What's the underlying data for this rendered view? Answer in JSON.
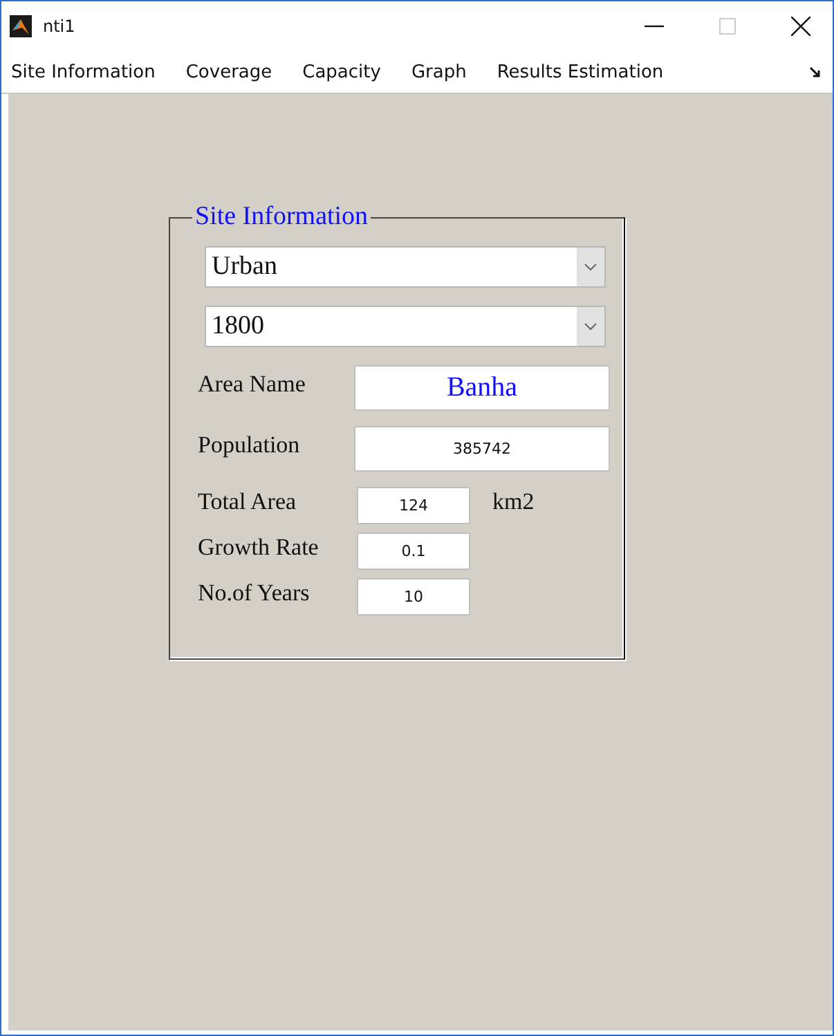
{
  "window": {
    "title": "nti1"
  },
  "menu": [
    "Site Information",
    "Coverage",
    "Capacity",
    "Graph",
    "Results Estimation"
  ],
  "panel": {
    "title": "Site Information",
    "dropdowns": [
      {
        "value": "Urban"
      },
      {
        "value": "1800"
      }
    ],
    "fields": [
      {
        "label": "Area Name",
        "value": "Banha",
        "kind": "wide",
        "emphasis": true
      },
      {
        "label": "Population",
        "value": "385742",
        "kind": "wide",
        "emphasis": false
      },
      {
        "label": "Total Area",
        "value": "124",
        "kind": "narrow",
        "emphasis": false,
        "unit": "km2"
      },
      {
        "label": "Growth Rate",
        "value": "0.1",
        "kind": "narrow",
        "emphasis": false
      },
      {
        "label": "No.of Years",
        "value": "10",
        "kind": "narrow",
        "emphasis": false
      }
    ]
  }
}
